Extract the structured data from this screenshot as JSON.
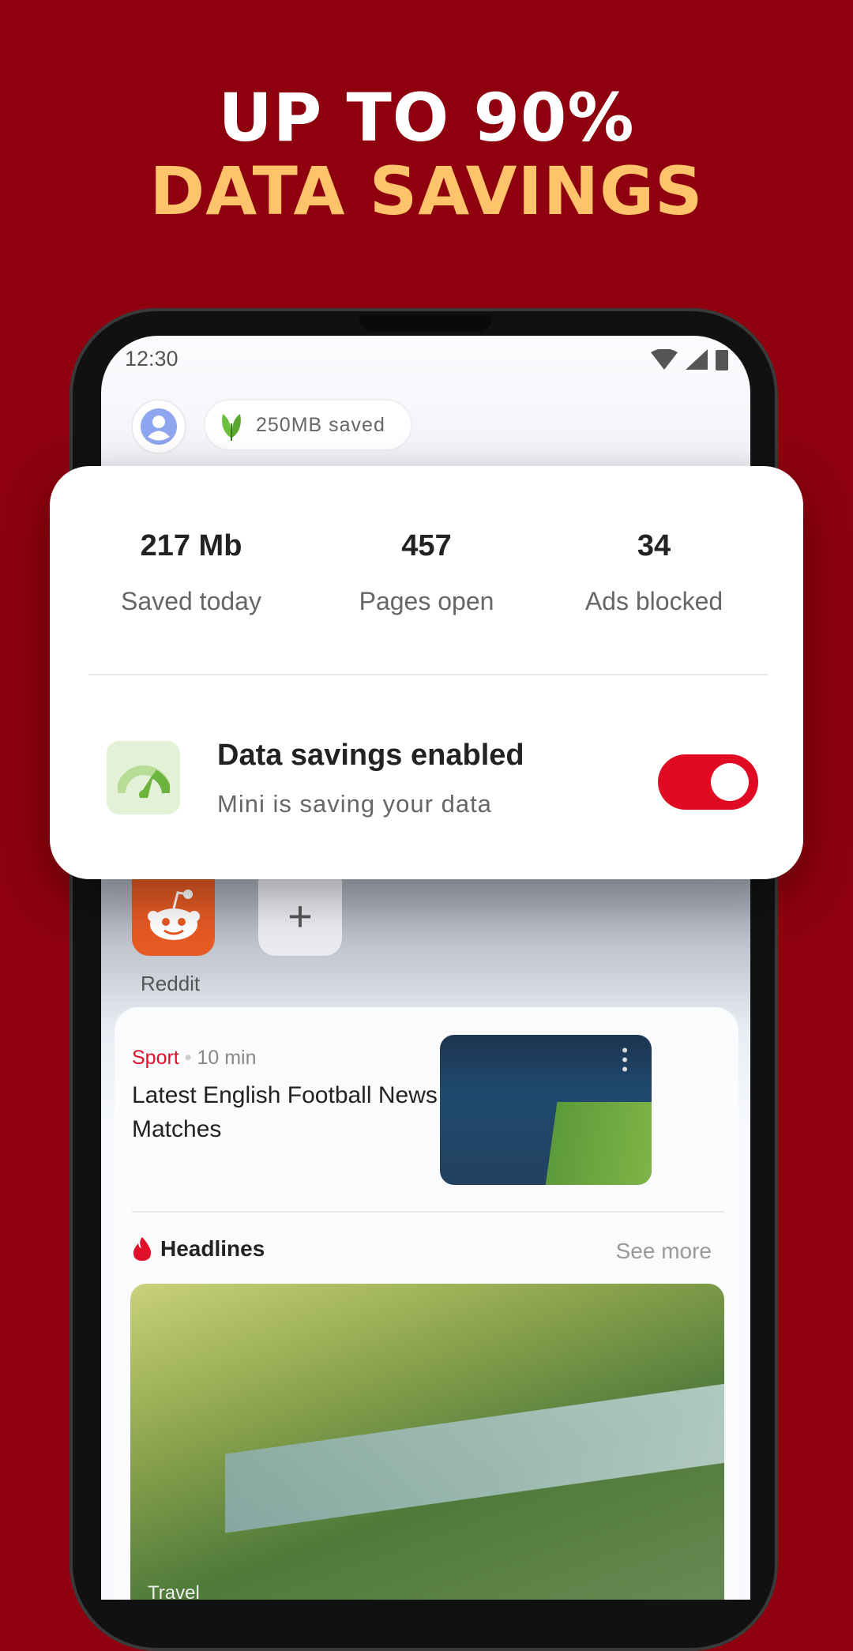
{
  "headline": {
    "line1": "UP TO 90%",
    "line2": "DATA SAVINGS"
  },
  "status_bar": {
    "time": "12:30",
    "icons": [
      "wifi-icon",
      "signal-icon",
      "battery-icon"
    ]
  },
  "top_bar": {
    "saved_chip": "250MB saved"
  },
  "stats_card": {
    "stats": [
      {
        "value": "217 Mb",
        "label": "Saved today"
      },
      {
        "value": "457",
        "label": "Pages open"
      },
      {
        "value": "34",
        "label": "Ads blocked"
      }
    ],
    "data_savings": {
      "title": "Data savings enabled",
      "subtitle": "Mini is saving your data",
      "enabled": true
    }
  },
  "speed_dial": [
    {
      "label": "Reddit"
    },
    {
      "label": "+"
    }
  ],
  "news": {
    "category": "Sport",
    "separator": "•",
    "time": "10 min",
    "title": "Latest English Football News & Matches"
  },
  "headlines": {
    "title": "Headlines",
    "see_more": "See more",
    "card_category": "Travel"
  },
  "colors": {
    "background": "#8e000e",
    "accent_yellow": "#ffc46b",
    "toggle": "#e00a22",
    "category": "#e0102a"
  }
}
